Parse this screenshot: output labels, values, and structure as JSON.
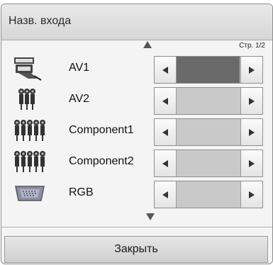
{
  "dialog": {
    "title": "Назв. входа",
    "page_indicator": "Стр. 1/2",
    "close_label": "Закрыть"
  },
  "inputs": [
    {
      "label": "AV1",
      "icon": "scart-connector-icon",
      "selected": true
    },
    {
      "label": "AV2",
      "icon": "composite-rca-connector-icon",
      "selected": false
    },
    {
      "label": "Component1",
      "icon": "component-rca-connector-icon",
      "selected": false
    },
    {
      "label": "Component2",
      "icon": "component-rca-connector-icon",
      "selected": false
    },
    {
      "label": "RGB",
      "icon": "vga-connector-icon",
      "selected": false
    }
  ],
  "colors": {
    "selected_value": "#6a6a6a",
    "unselected_value": "#c9c9c9"
  }
}
